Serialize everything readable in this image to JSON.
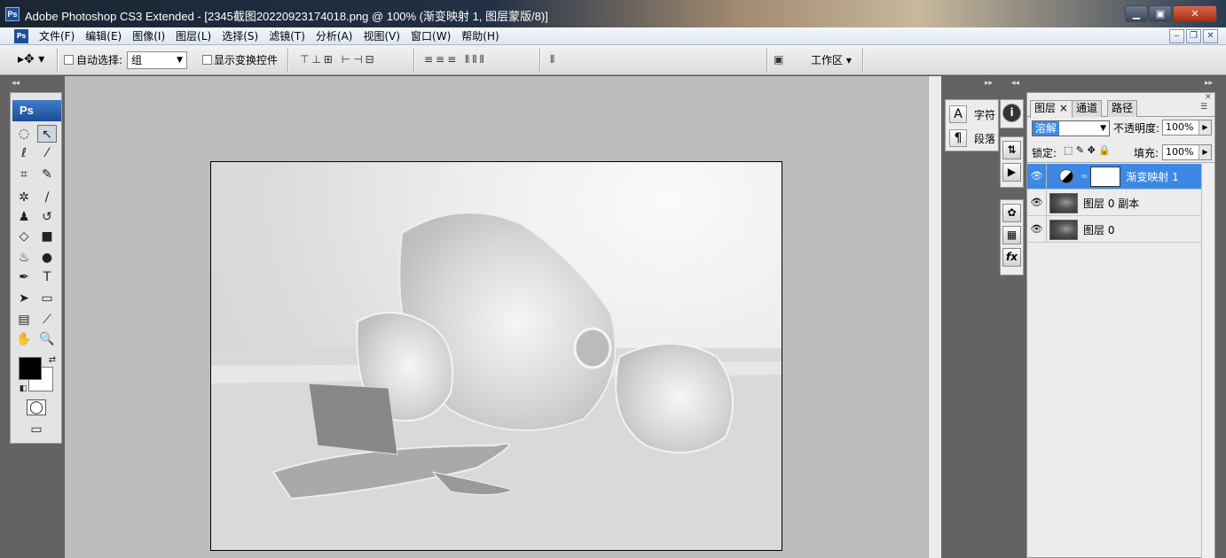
{
  "window": {
    "title": "Adobe Photoshop CS3 Extended - [2345截图20220923174018.png @ 100% (渐变映射 1, 图层蒙版/8)]",
    "app_icon": "Ps",
    "controls": {
      "minimize": "▁",
      "maximize": "▣",
      "close": "✕"
    }
  },
  "menubar": {
    "items": [
      "文件(F)",
      "编辑(E)",
      "图像(I)",
      "图层(L)",
      "选择(S)",
      "滤镜(T)",
      "分析(A)",
      "视图(V)",
      "窗口(W)",
      "帮助(H)"
    ],
    "doc_controls": {
      "minimize": "‒",
      "restore": "❐",
      "close": "✕"
    }
  },
  "options": {
    "tool_preset": "▸✥ ▾",
    "auto_select_label": "自动选择:",
    "auto_select_value": "组",
    "show_transform_label": "显示变换控件",
    "workspace_label": "工作区 ▾"
  },
  "toolbox": {
    "logo": "Ps",
    "tools": [
      {
        "name": "marquee-tool-icon",
        "glyph": "◌"
      },
      {
        "name": "move-tool-icon",
        "glyph": "↖"
      },
      {
        "name": "lasso-tool-icon",
        "glyph": "ℓ"
      },
      {
        "name": "magic-wand-tool-icon",
        "glyph": "⁄"
      },
      {
        "name": "crop-tool-icon",
        "glyph": "⌗"
      },
      {
        "name": "slice-tool-icon",
        "glyph": "✎"
      },
      {
        "name": "healing-brush-tool-icon",
        "glyph": "✲"
      },
      {
        "name": "brush-tool-icon",
        "glyph": "/"
      },
      {
        "name": "clone-stamp-tool-icon",
        "glyph": "♟"
      },
      {
        "name": "history-brush-tool-icon",
        "glyph": "↺"
      },
      {
        "name": "eraser-tool-icon",
        "glyph": "◇"
      },
      {
        "name": "gradient-tool-icon",
        "glyph": "■"
      },
      {
        "name": "blur-tool-icon",
        "glyph": "♨"
      },
      {
        "name": "dodge-tool-icon",
        "glyph": "●"
      },
      {
        "name": "pen-tool-icon",
        "glyph": "✒"
      },
      {
        "name": "type-tool-icon",
        "glyph": "T"
      },
      {
        "name": "path-selection-tool-icon",
        "glyph": "➤"
      },
      {
        "name": "shape-tool-icon",
        "glyph": "▭"
      },
      {
        "name": "notes-tool-icon",
        "glyph": "▤"
      },
      {
        "name": "eyedropper-tool-icon",
        "glyph": "⟋"
      },
      {
        "name": "hand-tool-icon",
        "glyph": "✋"
      },
      {
        "name": "zoom-tool-icon",
        "glyph": "🔍"
      }
    ],
    "quick_mask": "◯",
    "screen_mode": "▭"
  },
  "right_panels": {
    "character_label": "字符",
    "paragraph_label": "段落",
    "character_icon": "A",
    "paragraph_icon": "¶",
    "strip1": [
      "i"
    ],
    "strip2": [
      "⇅",
      "▶"
    ],
    "strip3": [
      "✿",
      "▦",
      "fx"
    ]
  },
  "layers": {
    "tabs": [
      {
        "label": "图层 ×",
        "active": true
      },
      {
        "label": "通道",
        "active": false
      },
      {
        "label": "路径",
        "active": false
      }
    ],
    "blend_mode": "溶解",
    "opacity_label": "不透明度:",
    "opacity_value": "100%",
    "lock_label": "锁定:",
    "lock_icons": "⬚ ✎ ✥ 🔒",
    "fill_label": "填充:",
    "fill_value": "100%",
    "rows": [
      {
        "name": "渐变映射 1",
        "type": "adjustment",
        "active": true
      },
      {
        "name": "图层 0 副本",
        "type": "image",
        "active": false
      },
      {
        "name": "图层 0",
        "type": "image",
        "active": false
      }
    ]
  }
}
